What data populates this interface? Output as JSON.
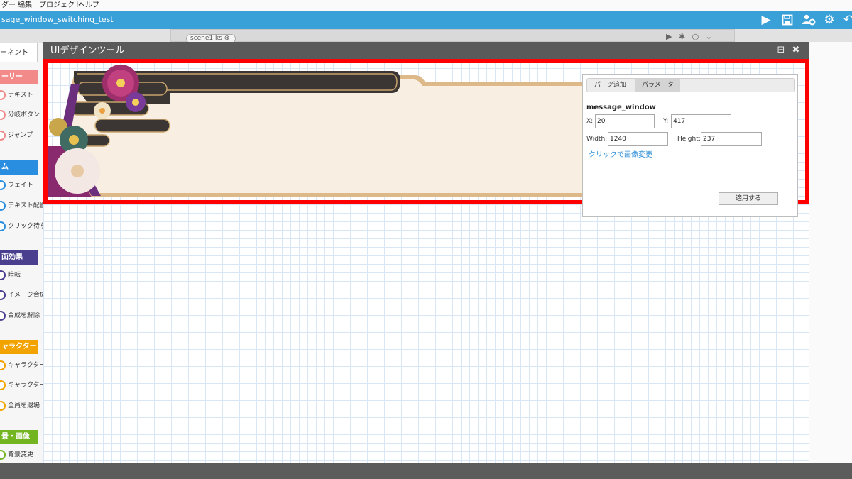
{
  "menu": {
    "items": [
      "ダー",
      "編集",
      "プロジェクト",
      "ヘルプ"
    ]
  },
  "app": {
    "project_title": "sage_window_switching_test",
    "toolbar": [
      "play-icon",
      "save-icon",
      "users-gear-icon",
      "gear-icon",
      "undo-icon"
    ]
  },
  "editor": {
    "scene_tab": "scene1.ks ⊗",
    "scene_tools": "▶ ✱ ○ ⌄"
  },
  "palette": {
    "tab_label": "ーネント",
    "sections": [
      {
        "title": "ーリー",
        "color": "#f28a8a",
        "items": [
          "テキスト",
          "分岐ボタン",
          "ジャンプ"
        ]
      },
      {
        "title": "ム",
        "color": "#2a8ee0",
        "items": [
          "ウェイト",
          "テキスト配置",
          "クリック待ち"
        ]
      },
      {
        "title": "面効果",
        "color": "#4a3f8f",
        "items": [
          "暗転",
          "イメージ合成",
          "合成を解除"
        ]
      },
      {
        "title": "ャラクター",
        "color": "#f2a300",
        "items": [
          "キャラクター",
          "キャラクター",
          "全員を退場"
        ]
      },
      {
        "title": "景・画像",
        "color": "#73b520",
        "items": [
          "背景変更"
        ]
      }
    ]
  },
  "dialog": {
    "title": "UIデザインツール",
    "minimize": "⊟",
    "close": "✖"
  },
  "panel": {
    "tabs": [
      "パーツ追加",
      "パラメータ"
    ],
    "active_tab": 1,
    "name": "message_window",
    "x_label": "X:",
    "x_value": "20",
    "y_label": "Y:",
    "y_value": "417",
    "w_label": "Width:",
    "w_value": "1240",
    "h_label": "Height:",
    "h_value": "237",
    "change_image": "クリックで画像変更",
    "apply": "適用する"
  },
  "colors": {
    "accent": "#3aa0d8",
    "highlight": "#ff0000",
    "dialog_title": "#5a5a5a"
  }
}
